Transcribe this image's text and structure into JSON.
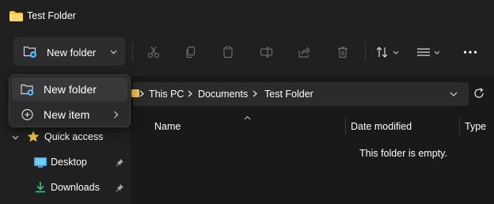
{
  "window": {
    "title": "Test Folder",
    "icon": "folder-icon"
  },
  "toolbar": {
    "new_folder_label": "New folder",
    "buttons": [
      {
        "name": "cut-icon"
      },
      {
        "name": "copy-icon"
      },
      {
        "name": "paste-icon"
      },
      {
        "name": "rename-icon"
      },
      {
        "name": "share-icon"
      },
      {
        "name": "delete-icon"
      },
      {
        "name": "sort-icon"
      },
      {
        "name": "view-icon"
      },
      {
        "name": "more-icon"
      }
    ]
  },
  "address": {
    "breadcrumbs": [
      "This PC",
      "Documents",
      "Test Folder"
    ]
  },
  "sidebar": {
    "items": [
      {
        "label": "Quick access",
        "icon": "star-icon"
      },
      {
        "label": "Desktop",
        "icon": "desktop-icon",
        "pinned": true
      },
      {
        "label": "Downloads",
        "icon": "download-icon",
        "pinned": true
      }
    ]
  },
  "columns": [
    "Name",
    "Date modified",
    "Type"
  ],
  "empty_message": "This folder is empty.",
  "new_menu": {
    "items": [
      {
        "label": "New folder",
        "icon": "new-folder-icon"
      },
      {
        "label": "New item",
        "icon": "add-icon",
        "has_submenu": true
      }
    ]
  },
  "colors": {
    "background": "#202020",
    "content": "#191919",
    "panel": "#2b2b2b",
    "folder_yellow": "#f7c344",
    "accent_blue": "#4cc2ff"
  }
}
